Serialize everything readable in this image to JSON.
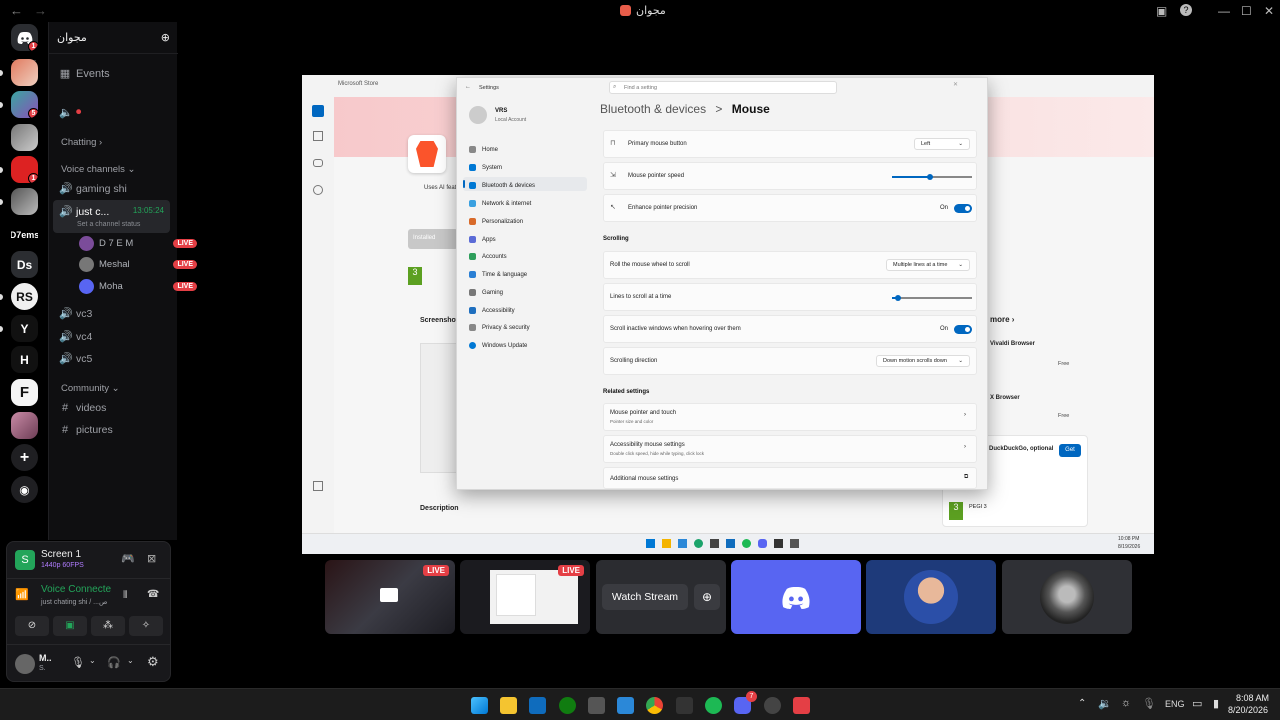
{
  "titlebar": {
    "server_name": "مجوان"
  },
  "rail": {
    "servers": [
      {
        "label": "",
        "badge": "1"
      },
      {
        "label": "",
        "badge": ""
      },
      {
        "label": "",
        "badge": "5"
      },
      {
        "label": "",
        "badge": ""
      },
      {
        "label": "",
        "badge": "1"
      },
      {
        "label": "",
        "badge": ""
      },
      {
        "label": "D7ems",
        "badge": ""
      },
      {
        "label": "Ds",
        "badge": ""
      },
      {
        "label": "RS",
        "badge": ""
      },
      {
        "label": "",
        "badge": ""
      },
      {
        "label": "H",
        "badge": ""
      },
      {
        "label": "F",
        "badge": ""
      },
      {
        "label": "",
        "badge": ""
      }
    ]
  },
  "channels": {
    "header": "مجوان",
    "events": "Events",
    "category_chatting": "Chatting",
    "category_voice": "Voice channels",
    "vc_gaming": "gaming shi",
    "vc_active": "just c...",
    "vc_active_time": "13:05:24",
    "vc_active_status": "Set a channel status",
    "users": [
      {
        "name": "D 7 E M",
        "live": "LIVE"
      },
      {
        "name": "Meshal",
        "live": "LIVE"
      },
      {
        "name": "Moha",
        "live": "LIVE"
      }
    ],
    "vc3": "vc3",
    "vc4": "vc4",
    "vc5": "vc5",
    "category_community": "Community",
    "videos": "videos",
    "pictures": "pictures"
  },
  "panel": {
    "screen_title": "Screen 1",
    "screen_quality": "1440p 60FPS",
    "voice_connected": "Voice Connecte",
    "voice_channel": "just chating shi / ...ص",
    "user_name": "M..",
    "user_status": "S."
  },
  "stream": {
    "store_app_title": "Microsoft Store",
    "store_installed": "Installed",
    "store_screenshots": "Screenshots",
    "store_description": "Description",
    "store_more": "more",
    "store_vivaldi": "Vivaldi Browser",
    "store_free1": "Free",
    "store_brave_x": "X Browser",
    "store_free2": "Free",
    "store_ddg": "DuckDuckGo, optional",
    "store_get": "Get",
    "store_pegi": "PEGI 3",
    "store_uses_ai": "Uses AI feat",
    "win_time": "10:08 PM",
    "win_date": "8/19/2026",
    "settings": {
      "title": "Settings",
      "search": "Find a setting",
      "user_name": "VRS",
      "user_type": "Local Account",
      "breadcrumb_parent": "Bluetooth & devices",
      "breadcrumb_sep": ">",
      "breadcrumb_current": "Mouse",
      "nav": [
        "Home",
        "System",
        "Bluetooth & devices",
        "Network & internet",
        "Personalization",
        "Apps",
        "Accounts",
        "Time & language",
        "Gaming",
        "Accessibility",
        "Privacy & security",
        "Windows Update"
      ],
      "primary_button_label": "Primary mouse button",
      "primary_button_value": "Left",
      "pointer_speed": "Mouse pointer speed",
      "enhance_precision": "Enhance pointer precision",
      "on1": "On",
      "scrolling_header": "Scrolling",
      "roll_wheel": "Roll the mouse wheel to scroll",
      "roll_value": "Multiple lines at a time",
      "lines_scroll": "Lines to scroll at a time",
      "scroll_inactive": "Scroll inactive windows when hovering over them",
      "on2": "On",
      "scroll_direction": "Scrolling direction",
      "scroll_direction_value": "Down motion scrolls down",
      "related_header": "Related settings",
      "pointer_touch": "Mouse pointer and touch",
      "pointer_touch_sub": "Pointer size and color",
      "access_mouse": "Accessibility mouse settings",
      "access_mouse_sub": "Double click speed, hide while typing, click lock",
      "additional": "Additional mouse settings"
    }
  },
  "tiles": {
    "live1": "LIVE",
    "live2": "LIVE",
    "watch_stream": "Watch Stream"
  },
  "taskbar": {
    "lang": "ENG",
    "time": "8:08 AM",
    "date": "8/20/2026",
    "discord_badge": "7"
  },
  "colors": {
    "accent": "#5865f2",
    "live": "#e43f45",
    "online": "#23a55a",
    "win_accent": "#0067c0"
  }
}
